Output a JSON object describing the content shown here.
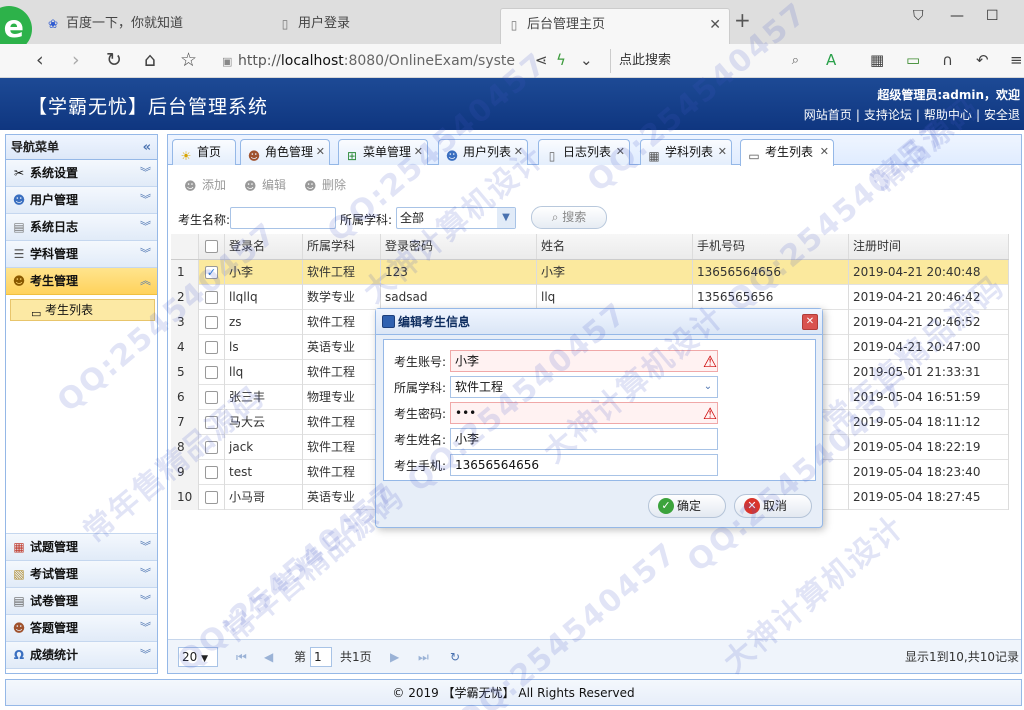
{
  "browser": {
    "tabs": [
      {
        "label": "百度一下，你就知道",
        "icon": "baidu-paw-icon"
      },
      {
        "label": "用户登录",
        "icon": "page-icon"
      },
      {
        "label": "后台管理主页",
        "icon": "page-icon"
      }
    ],
    "url": {
      "scheme": "http://",
      "host": "localhost",
      "path": ":8080/OnlineExam/syste"
    },
    "search_placeholder": "点此搜索"
  },
  "app": {
    "title": "【学霸无忧】后台管理系统",
    "welcome": "超级管理员:admin，欢迎",
    "links": [
      "网站首页",
      "支持论坛",
      "帮助中心",
      "安全退"
    ]
  },
  "sidebar": {
    "title": "导航菜单",
    "groups_top": [
      {
        "label": "系统设置",
        "icon": "tools-icon"
      },
      {
        "label": "用户管理",
        "icon": "users-icon"
      },
      {
        "label": "系统日志",
        "icon": "log-icon"
      },
      {
        "label": "学科管理",
        "icon": "list-icon"
      }
    ],
    "active_group": {
      "label": "考生管理",
      "icon": "students-icon"
    },
    "active_item": "考生列表",
    "groups_bottom": [
      {
        "label": "试题管理",
        "icon": "calendar-icon"
      },
      {
        "label": "考试管理",
        "icon": "exam-icon"
      },
      {
        "label": "试卷管理",
        "icon": "paper-icon"
      },
      {
        "label": "答题管理",
        "icon": "answer-icon"
      },
      {
        "label": "成绩统计",
        "icon": "stats-icon"
      }
    ]
  },
  "tabs": [
    {
      "label": "首页",
      "icon": "bulb-icon",
      "closable": false
    },
    {
      "label": "角色管理",
      "icon": "role-icon",
      "closable": true
    },
    {
      "label": "菜单管理",
      "icon": "tree-icon",
      "closable": true
    },
    {
      "label": "用户列表",
      "icon": "users-icon",
      "closable": true
    },
    {
      "label": "日志列表",
      "icon": "doc-icon",
      "closable": true
    },
    {
      "label": "学科列表",
      "icon": "table-icon",
      "closable": true
    },
    {
      "label": "考生列表",
      "icon": "card-icon",
      "closable": true
    }
  ],
  "toolbar": {
    "add": "添加",
    "edit": "编辑",
    "delete": "删除"
  },
  "filter": {
    "name_label": "考生名称:",
    "name_value": "",
    "subject_label": "所属学科:",
    "subject_value": "全部",
    "search": "搜索"
  },
  "grid": {
    "headers": [
      "登录名",
      "所属学科",
      "登录密码",
      "姓名",
      "手机号码",
      "注册时间"
    ],
    "rows": [
      {
        "n": "1",
        "checked": true,
        "login": "小李",
        "subject": "软件工程",
        "pwd": "123",
        "name": "小李",
        "phone": "13656564656",
        "time": "2019-04-21 20:40:48"
      },
      {
        "n": "2",
        "checked": false,
        "login": "llqllq",
        "subject": "数学专业",
        "pwd": "sadsad",
        "name": "llq",
        "phone": "1356565656",
        "time": "2019-04-21 20:46:42"
      },
      {
        "n": "3",
        "checked": false,
        "login": "zs",
        "subject": "软件工程",
        "pwd": "",
        "name": "",
        "phone": "",
        "time": "2019-04-21 20:46:52"
      },
      {
        "n": "4",
        "checked": false,
        "login": "ls",
        "subject": "英语专业",
        "pwd": "",
        "name": "",
        "phone": "",
        "time": "2019-04-21 20:47:00"
      },
      {
        "n": "5",
        "checked": false,
        "login": "llq",
        "subject": "软件工程",
        "pwd": "",
        "name": "",
        "phone": "",
        "time": "2019-05-01 21:33:31"
      },
      {
        "n": "6",
        "checked": false,
        "login": "张三丰",
        "subject": "物理专业",
        "pwd": "",
        "name": "",
        "phone": "",
        "time": "2019-05-04 16:51:59"
      },
      {
        "n": "7",
        "checked": false,
        "login": "马大云",
        "subject": "软件工程",
        "pwd": "",
        "name": "",
        "phone": "",
        "time": "2019-05-04 18:11:12"
      },
      {
        "n": "8",
        "checked": false,
        "login": "jack",
        "subject": "软件工程",
        "pwd": "",
        "name": "",
        "phone": "",
        "time": "2019-05-04 18:22:19"
      },
      {
        "n": "9",
        "checked": false,
        "login": "test",
        "subject": "软件工程",
        "pwd": "",
        "name": "",
        "phone": "",
        "time": "2019-05-04 18:23:40"
      },
      {
        "n": "10",
        "checked": false,
        "login": "小马哥",
        "subject": "英语专业",
        "pwd": "",
        "name": "",
        "phone": "",
        "time": "2019-05-04 18:27:45"
      }
    ]
  },
  "pager": {
    "page_size": "20",
    "page_label": "第",
    "page_value": "1",
    "total_pages": "共1页",
    "info": "显示1到10,共10记录"
  },
  "footer": "© 2019 【学霸无忧】 All Rights Reserved",
  "dialog": {
    "title": "编辑考生信息",
    "fields": [
      {
        "label": "考生账号:",
        "value": "小李",
        "invalid": true
      },
      {
        "label": "所属学科:",
        "value": "软件工程",
        "select": true
      },
      {
        "label": "考生密码:",
        "value": "•••",
        "invalid": true
      },
      {
        "label": "考生姓名:",
        "value": "小李"
      },
      {
        "label": "考生手机:",
        "value": "13656564656"
      }
    ],
    "ok": "确定",
    "cancel": "取消"
  },
  "watermark": {
    "qq": "QQ:254540457",
    "seller": "常年售精品源码",
    "design": "大神计算机设计",
    "source": "精品源码"
  },
  "colors": {
    "header": "#1d4a95",
    "highlight_row": "#fbe99e",
    "active_menu": "#ffd25c",
    "border": "#95b8e7"
  }
}
